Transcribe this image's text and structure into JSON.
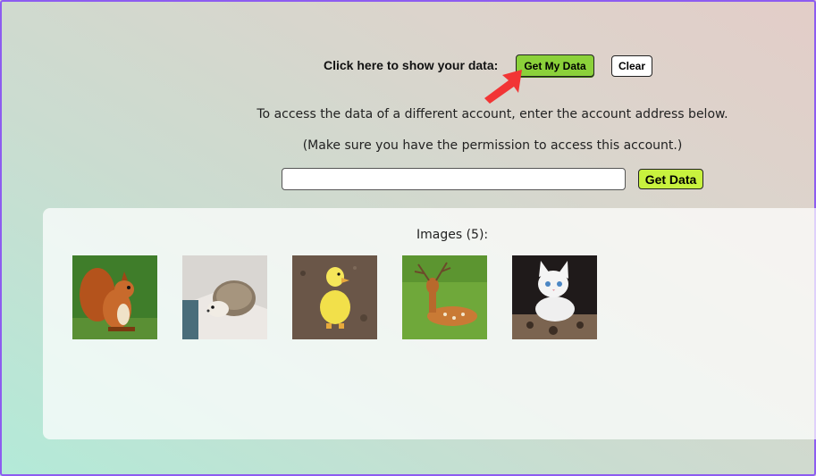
{
  "header": {
    "prompt": "Click here to show your data:",
    "get_my_data_label": "Get My Data",
    "clear_label": "Clear"
  },
  "instructions": {
    "line1": "To access the data of a different account, enter the account address below.",
    "line2": "(Make sure you have the permission to access this account.)"
  },
  "account": {
    "input_value": "",
    "get_data_label": "Get Data"
  },
  "images": {
    "heading": "Images (5):",
    "items": [
      {
        "subject": "squirrel"
      },
      {
        "subject": "hedgehog"
      },
      {
        "subject": "duckling"
      },
      {
        "subject": "deer"
      },
      {
        "subject": "kitten"
      }
    ]
  },
  "colors": {
    "get_my_data_bg": "#8bd13a",
    "get_data_bg": "#c8f23e",
    "frame_border": "#8d5cf0",
    "arrow": "#f23535"
  }
}
